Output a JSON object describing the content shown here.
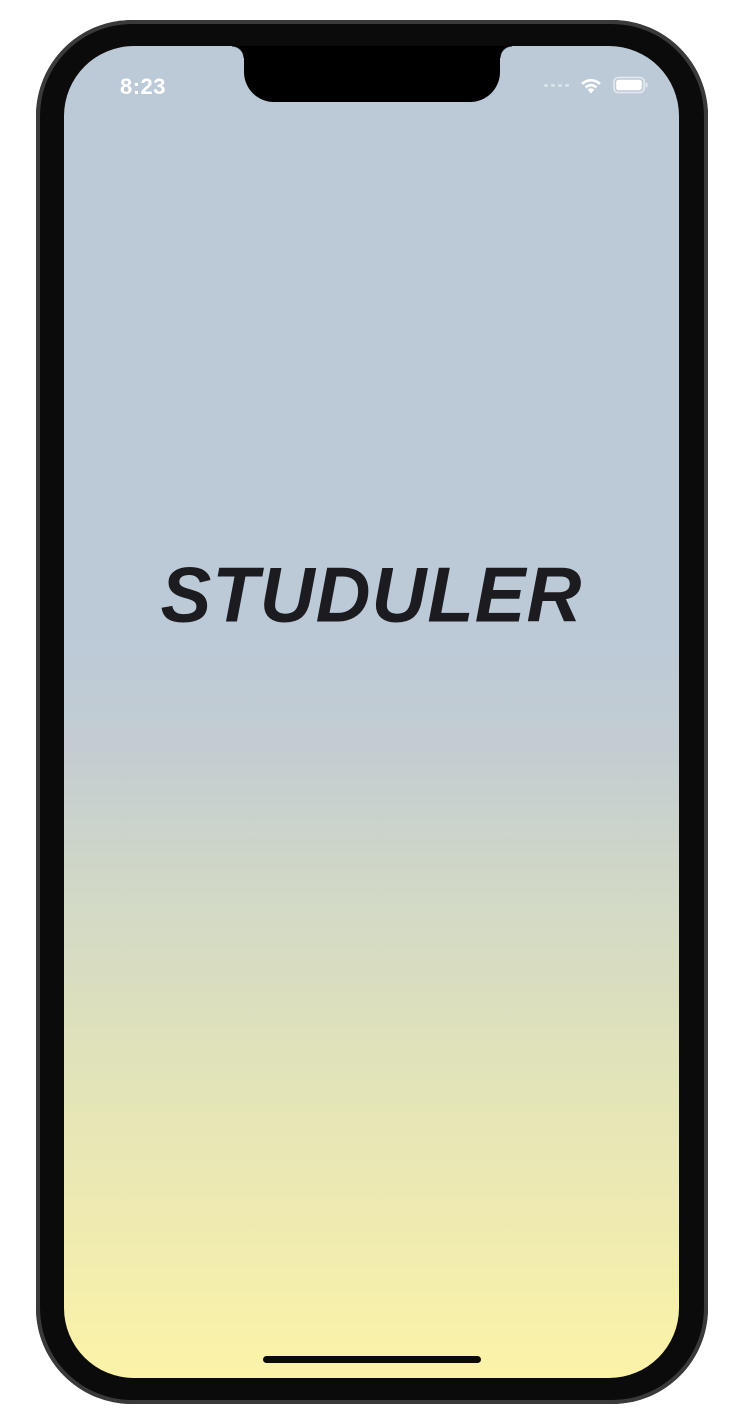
{
  "status_bar": {
    "time": "8:23",
    "signal_icon": "cellular-signal-icon",
    "wifi_icon": "wifi-icon",
    "battery_icon": "battery-icon"
  },
  "splash": {
    "title": "STUDULER"
  },
  "colors": {
    "gradient_top": "#bccad8",
    "gradient_bottom": "#fcf3a8",
    "title": "#1c1b20",
    "frame": "#0b0b0c"
  }
}
